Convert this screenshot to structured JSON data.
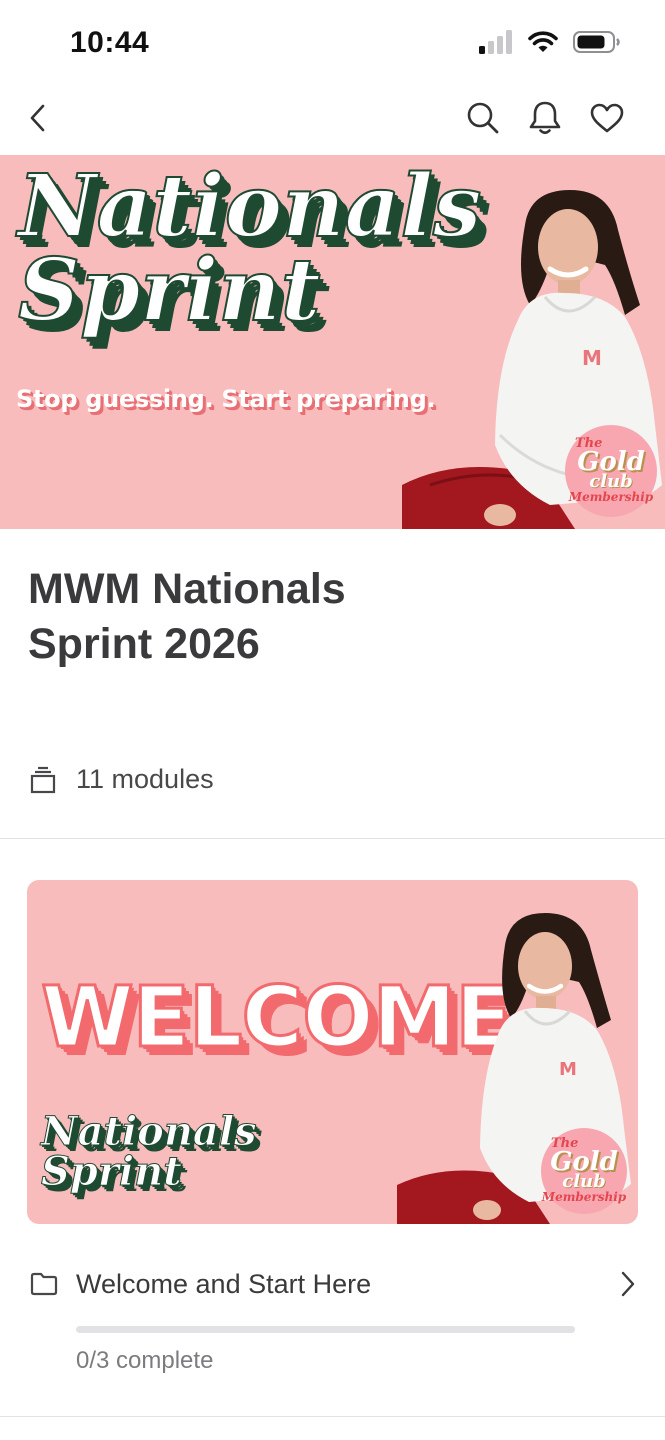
{
  "status_bar": {
    "time": "10:44",
    "icons": [
      "cellular-signal-icon",
      "wifi-icon",
      "battery-icon"
    ]
  },
  "nav": {
    "back_icon": "chevron-left-icon",
    "right_icons": [
      "search-icon",
      "bell-icon",
      "heart-icon"
    ]
  },
  "hero": {
    "title": "Nationals\nSprint",
    "tagline": "Stop guessing. Start preparing.",
    "badge": {
      "the": "The",
      "gold": "Gold",
      "club": "club",
      "membership": "Membership"
    },
    "colors": {
      "background": "#f9bcbd",
      "title_shadow": "#1f4a32",
      "tagline_shadow": "#e86f73"
    }
  },
  "course": {
    "title": "MWM Nationals\nSprint 2026",
    "modules_count": "11 modules",
    "modules_icon": "stack-icon"
  },
  "modules": [
    {
      "thumbnail": {
        "headline": "WELCOME",
        "subtitle": "Nationals\nSprint",
        "badge": {
          "the": "The",
          "gold": "Gold",
          "club": "club",
          "membership": "Membership"
        }
      },
      "icon": "folder-icon",
      "name": "Welcome and Start Here",
      "chevron": "chevron-right-icon",
      "progress_fraction": 0,
      "progress_text": "0/3 complete"
    }
  ]
}
